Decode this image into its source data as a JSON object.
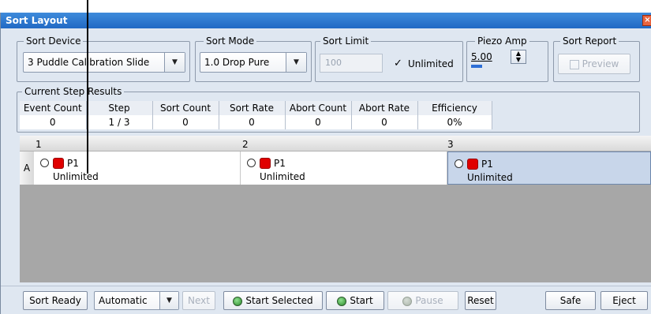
{
  "window": {
    "title": "Sort Layout",
    "close_glyph": "×"
  },
  "sort_device": {
    "legend": "Sort Device",
    "value": "3 Puddle Calibration Slide"
  },
  "sort_mode": {
    "legend": "Sort Mode",
    "value": "1.0 Drop Pure"
  },
  "sort_limit": {
    "legend": "Sort Limit",
    "value": "100",
    "unlimited_label": "Unlimited",
    "unlimited_checked": true
  },
  "piezo_amp": {
    "legend": "Piezo Amp",
    "value": "5.00"
  },
  "sort_report": {
    "legend": "Sort Report",
    "preview_label": "Preview"
  },
  "results": {
    "legend": "Current Step Results",
    "headers": [
      "Event Count",
      "Step",
      "Sort Count",
      "Sort Rate",
      "Abort Count",
      "Abort Rate",
      "Efficiency"
    ],
    "values": [
      "0",
      "1 / 3",
      "0",
      "0",
      "0",
      "0",
      "0%"
    ]
  },
  "plate": {
    "columns": [
      "1",
      "2",
      "3"
    ],
    "row": "A",
    "cells": [
      {
        "population": "P1",
        "limit": "Unlimited"
      },
      {
        "population": "P1",
        "limit": "Unlimited"
      },
      {
        "population": "P1",
        "limit": "Unlimited"
      }
    ]
  },
  "toolbar": {
    "sort_ready": "Sort Ready",
    "mode": "Automatic",
    "next": "Next",
    "start_selected": "Start Selected",
    "start": "Start",
    "pause": "Pause",
    "reset": "Reset",
    "safe": "Safe",
    "eject": "Eject"
  },
  "colors": {
    "titlebar": "#2169c4",
    "sort_indicator": "#e00000",
    "selected_cell": "#c8d6ea"
  }
}
